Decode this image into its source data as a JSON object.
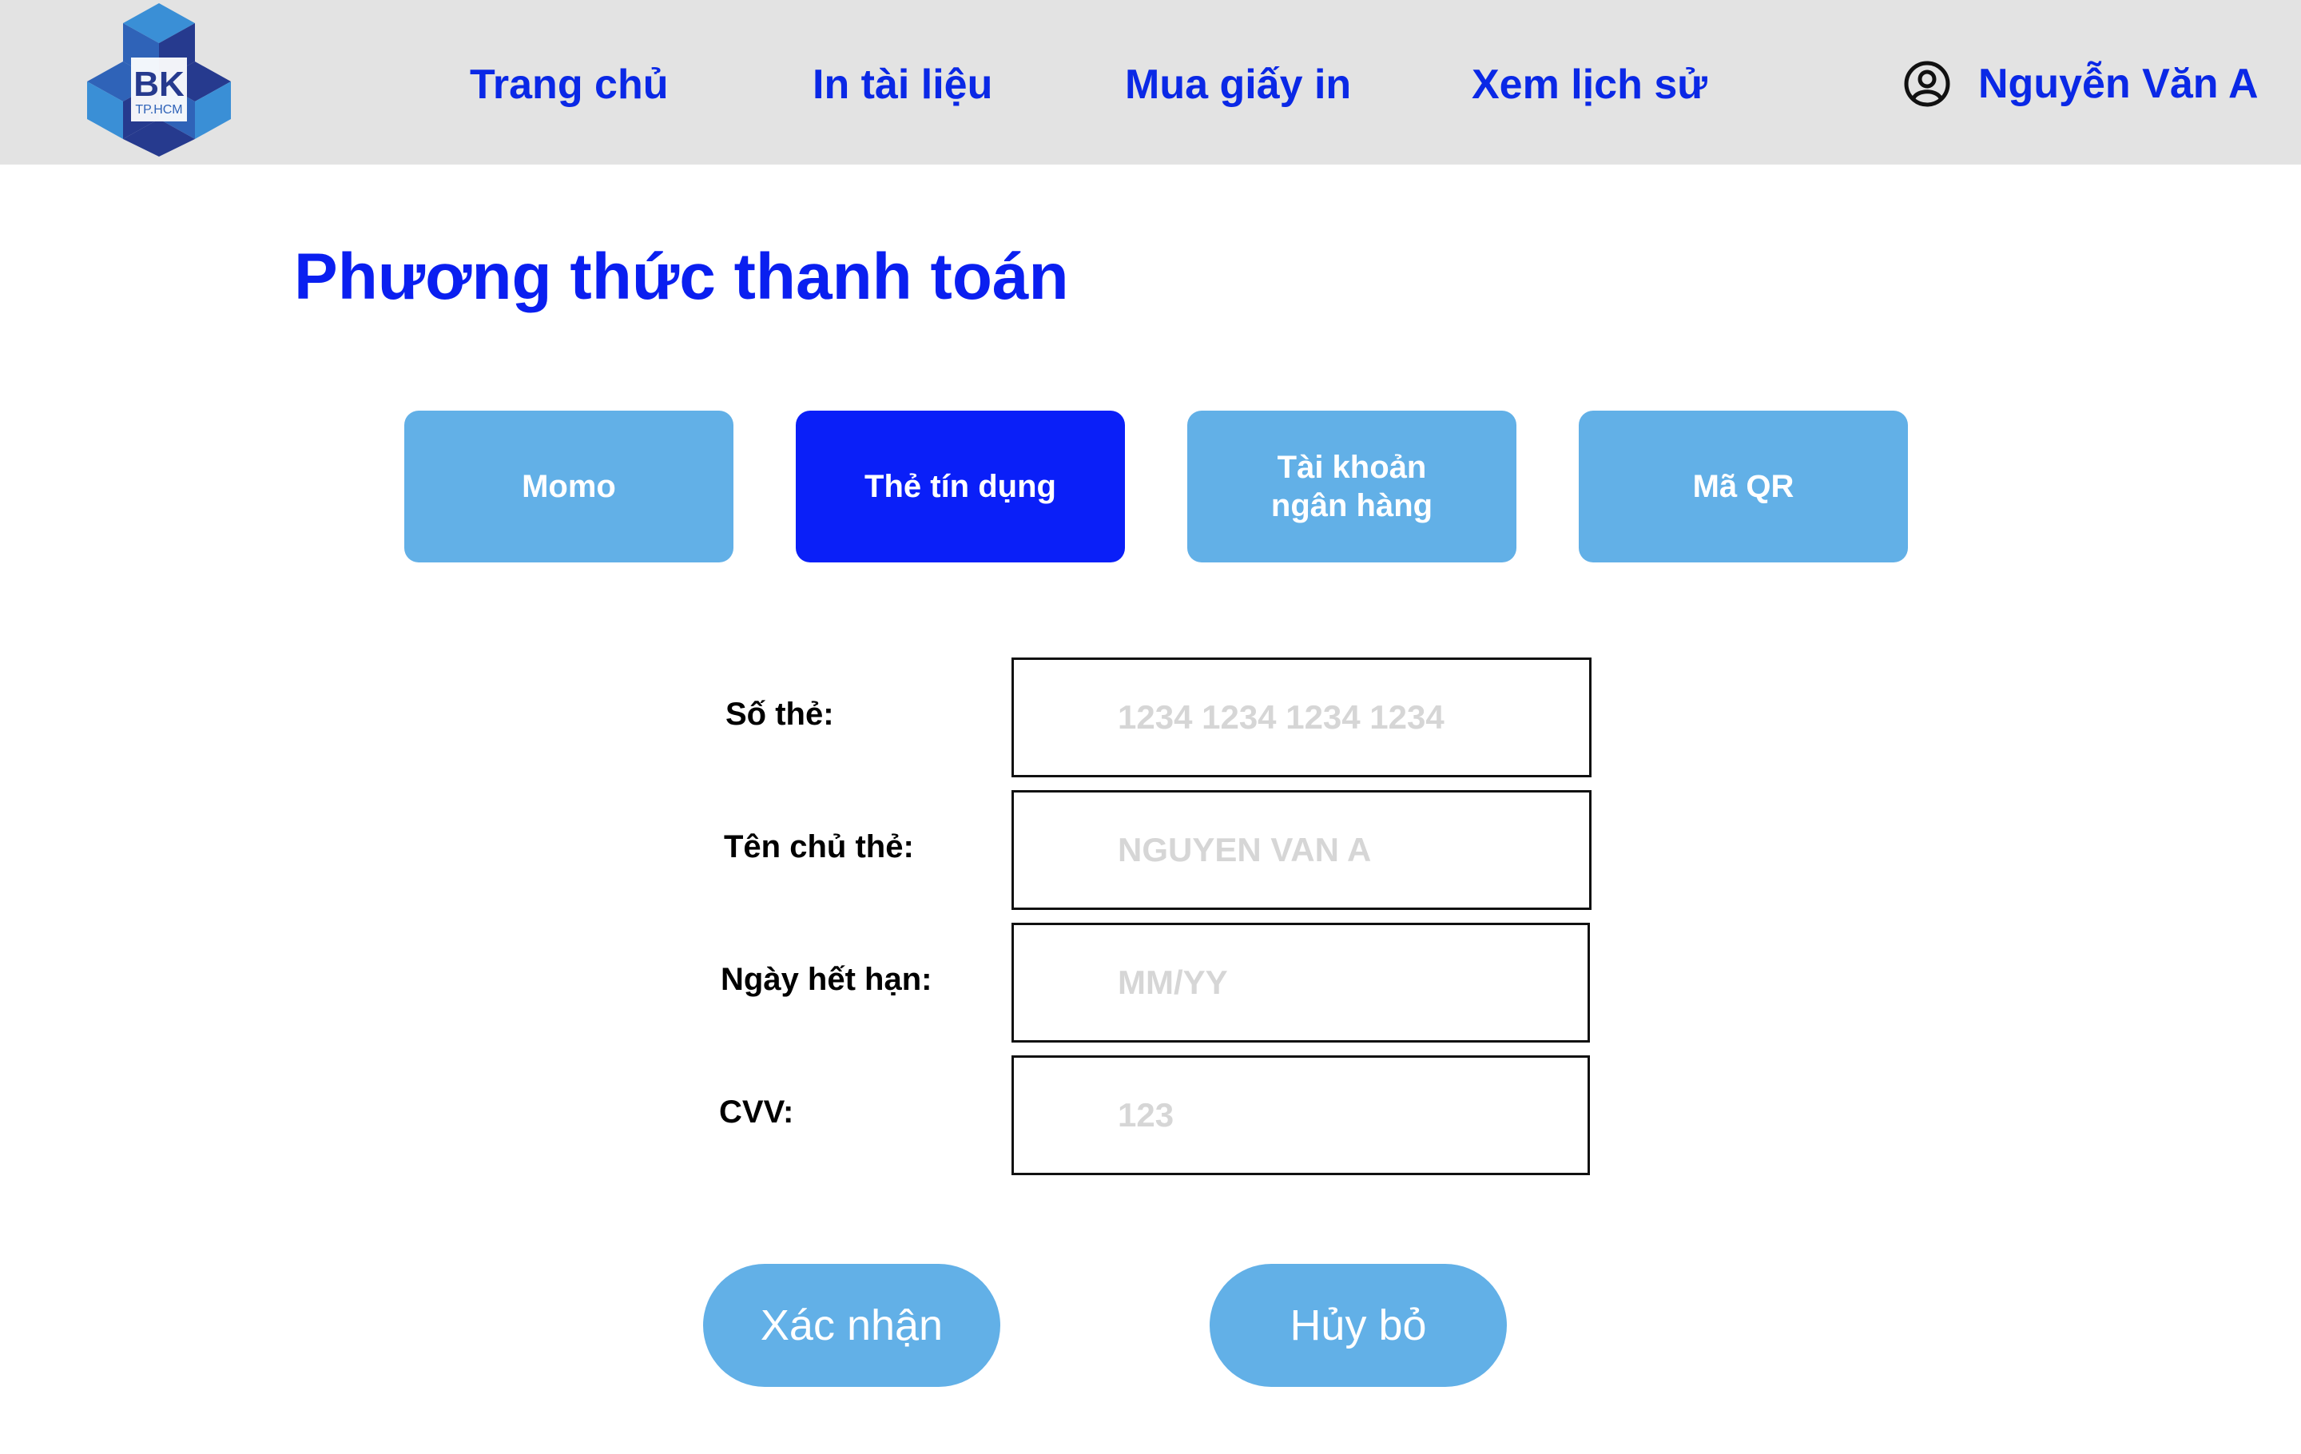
{
  "header": {
    "logo": {
      "text_main": "BK",
      "text_sub": "TP.HCM",
      "colors": {
        "dark": "#263a8e",
        "mid": "#2f63b8",
        "light": "#3a8fd6"
      }
    },
    "nav": [
      {
        "label": "Trang chủ",
        "active": false
      },
      {
        "label": "In tài liệu",
        "active": false
      },
      {
        "label": "Mua giấy in",
        "active": true
      },
      {
        "label": "Xem lịch sử",
        "active": false
      }
    ],
    "user": {
      "name": "Nguyễn Văn A",
      "icon": "user-circle-icon"
    }
  },
  "page": {
    "title": "Phương thức thanh toán"
  },
  "payment_methods": [
    {
      "label": "Momo",
      "active": false
    },
    {
      "label": "Thẻ tín dụng",
      "active": true
    },
    {
      "label": "Tài khoản\nngân hàng",
      "active": false
    },
    {
      "label": "Mã QR",
      "active": false
    }
  ],
  "form": {
    "card_number": {
      "label": "Số thẻ:",
      "placeholder": "1234 1234 1234 1234",
      "value": ""
    },
    "card_holder": {
      "label": "Tên chủ thẻ:",
      "placeholder": "NGUYEN VAN A",
      "value": ""
    },
    "expiry": {
      "label": "Ngày hết hạn:",
      "placeholder": "MM/YY",
      "value": ""
    },
    "cvv": {
      "label": "CVV:",
      "placeholder": "123",
      "value": ""
    }
  },
  "actions": {
    "confirm_label": "Xác nhận",
    "cancel_label": "Hủy bỏ"
  },
  "colors": {
    "brand_blue": "#0a28e6",
    "active_tab": "#0a1ff8",
    "inactive_tab": "#62b0e7",
    "header_bg": "#e3e3e3"
  }
}
